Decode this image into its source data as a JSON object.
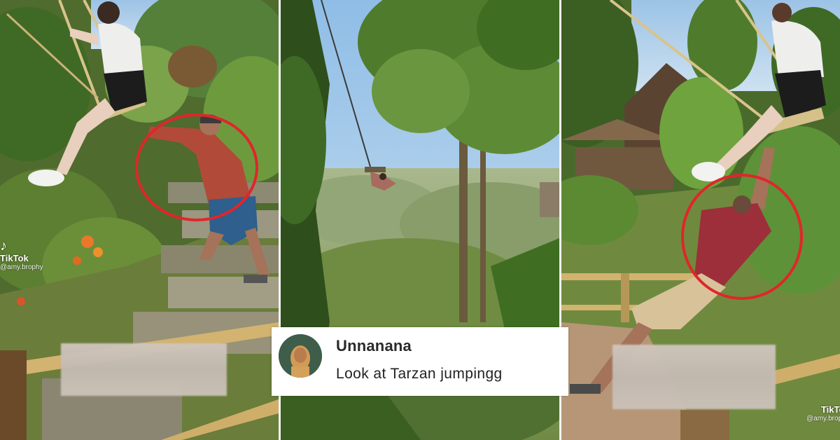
{
  "watermarks": {
    "left_logo": "TikTok",
    "left_user": "@amy.brophy",
    "right_logo": "TikTok",
    "right_user": "@amy.brophy"
  },
  "comment": {
    "username": "Unnanana",
    "text": "Look at Tarzan jumpingg",
    "avatar_icon": "profile-avatar"
  },
  "highlight_color": "#e0262a",
  "panels": [
    {
      "name": "panel-left",
      "scene": "man pushing woman on rope swing"
    },
    {
      "name": "panel-middle",
      "scene": "woman swinging over jungle valley"
    },
    {
      "name": "panel-right",
      "scene": "man hanging from swing"
    }
  ]
}
